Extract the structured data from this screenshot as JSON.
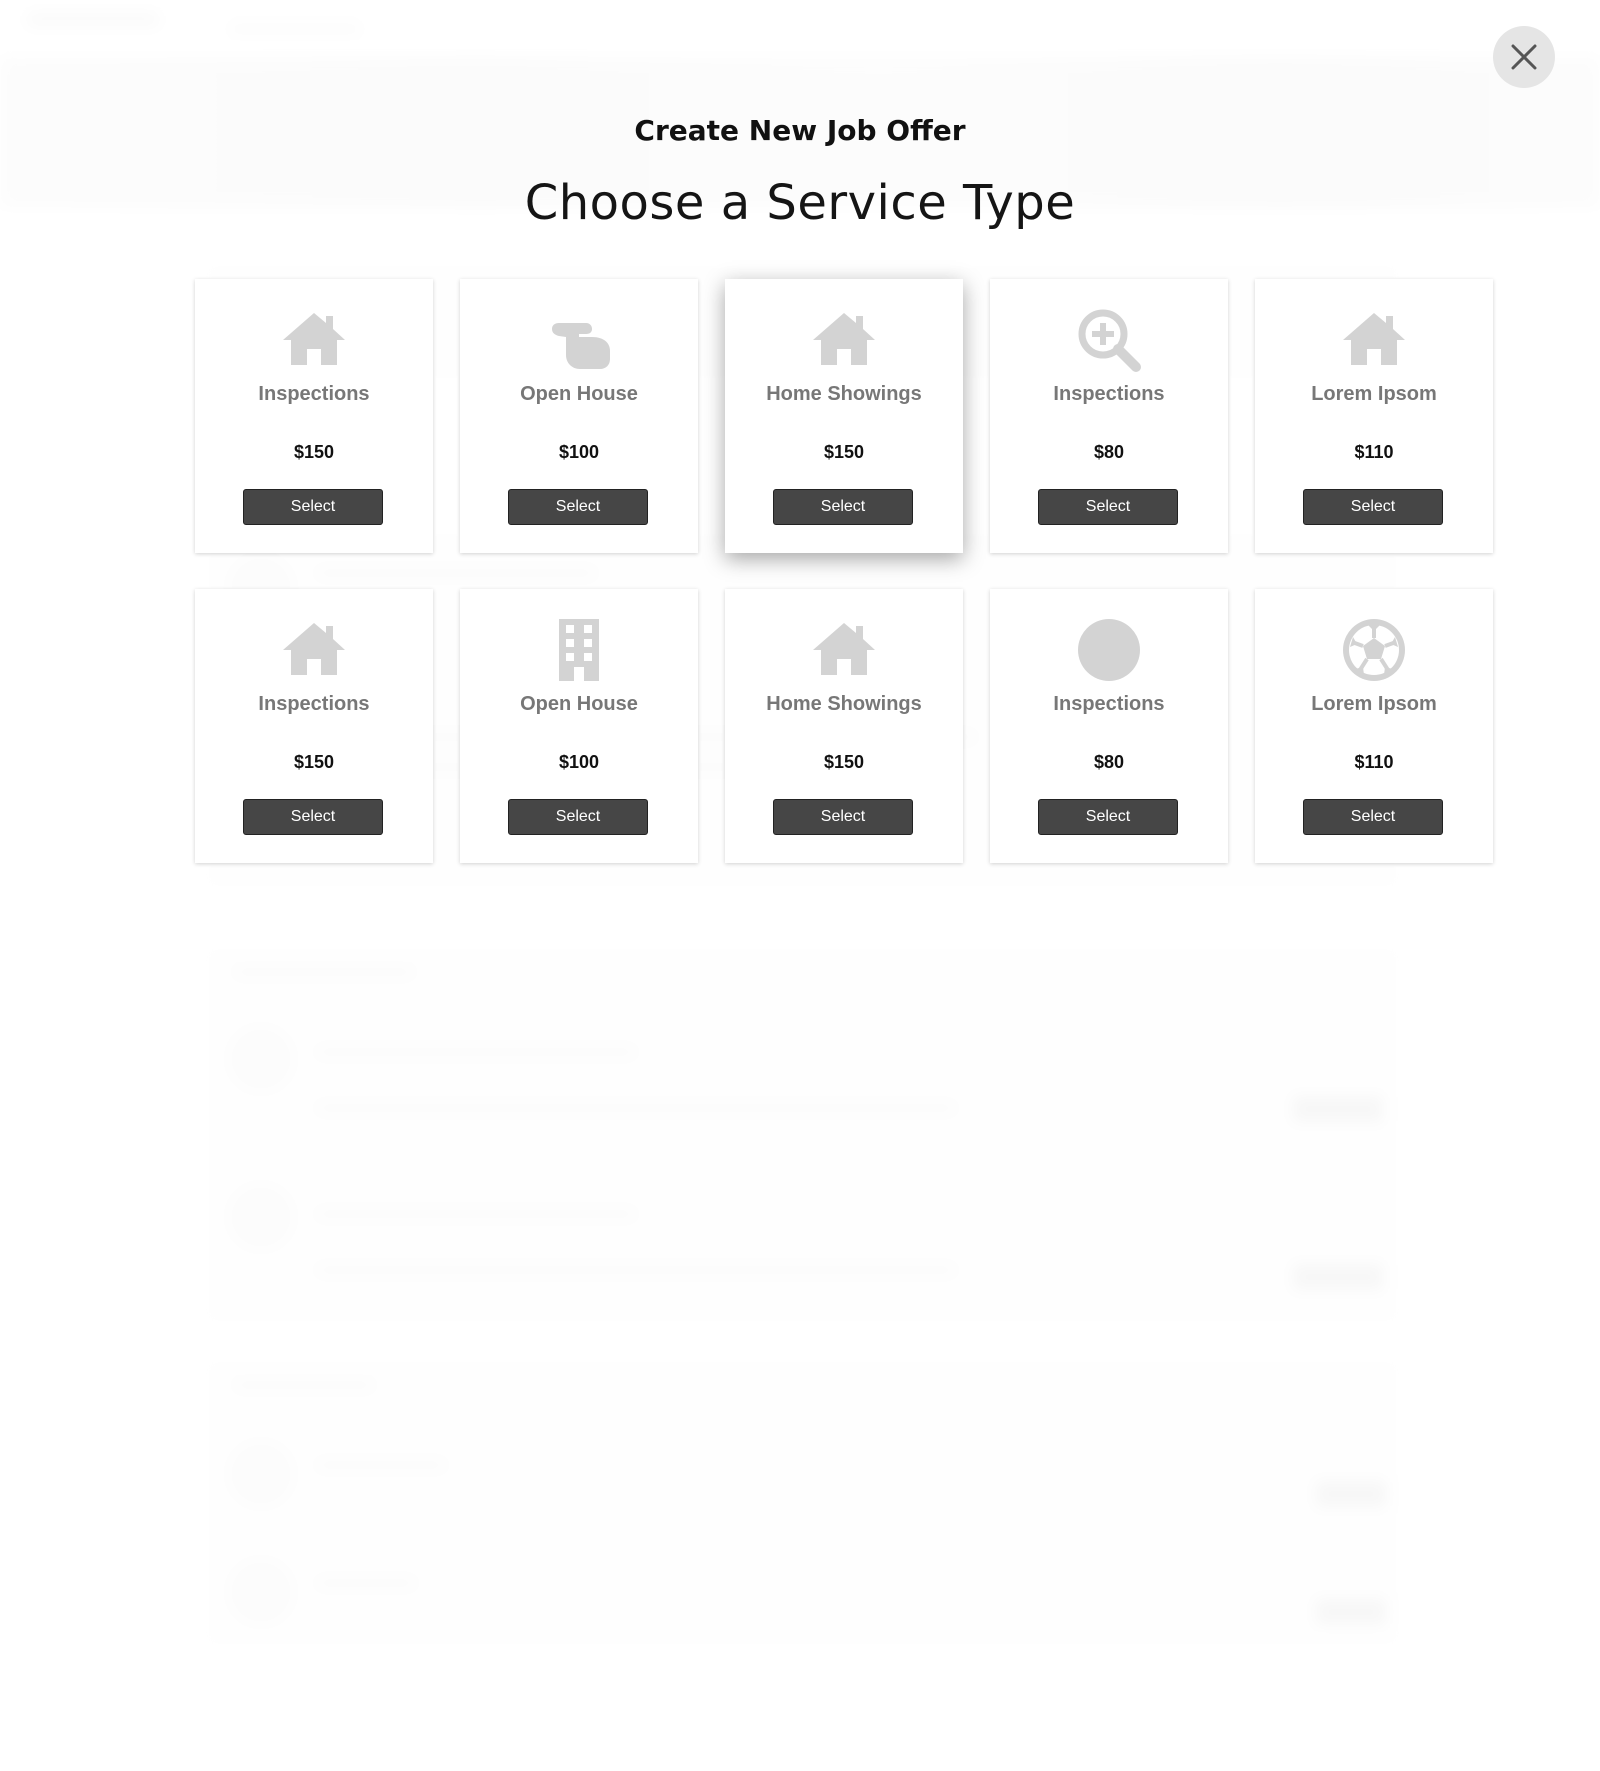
{
  "modal": {
    "title": "Create New Job Offer",
    "subtitle": "Choose a Service Type",
    "close_label": "close"
  },
  "services": [
    {
      "name": "Inspections",
      "price": "$150",
      "icon": "house-icon",
      "button": "Select"
    },
    {
      "name": "Open House",
      "price": "$100",
      "icon": "hand-peace-icon",
      "button": "Select"
    },
    {
      "name": "Home Showings",
      "price": "$150",
      "icon": "house-icon",
      "button": "Select"
    },
    {
      "name": "Inspections",
      "price": "$80",
      "icon": "zoom-in-icon",
      "button": "Select"
    },
    {
      "name": "Lorem Ipsom",
      "price": "$110",
      "icon": "house-icon",
      "button": "Select"
    },
    {
      "name": "Inspections",
      "price": "$150",
      "icon": "house-icon",
      "button": "Select"
    },
    {
      "name": "Open House",
      "price": "$100",
      "icon": "building-icon",
      "button": "Select"
    },
    {
      "name": "Home Showings",
      "price": "$150",
      "icon": "house-icon",
      "button": "Select"
    },
    {
      "name": "Inspections",
      "price": "$80",
      "icon": "circle-icon",
      "button": "Select"
    },
    {
      "name": "Lorem Ipsom",
      "price": "$110",
      "icon": "soccer-ball-icon",
      "button": "Select"
    }
  ],
  "colors": {
    "icon": "#d3d3d3",
    "service_name": "#777777",
    "button_bg": "#464646"
  }
}
